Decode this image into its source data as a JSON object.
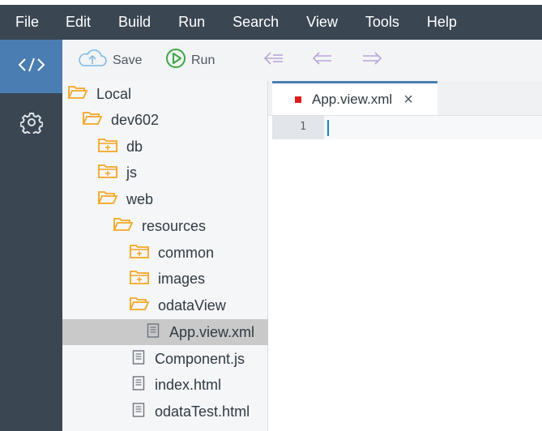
{
  "menubar": {
    "items": [
      "File",
      "Edit",
      "Build",
      "Run",
      "Search",
      "View",
      "Tools",
      "Help"
    ]
  },
  "leftbar": {
    "items": [
      {
        "icon": "code-brackets-icon",
        "active": true
      },
      {
        "icon": "gear-icon",
        "active": false
      }
    ]
  },
  "toolbar": {
    "save_label": "Save",
    "run_label": "Run",
    "icons": [
      "cloud-upload-icon",
      "play-circle-icon",
      "double-arrow-left-icon",
      "arrow-left-icon",
      "arrow-right-icon"
    ]
  },
  "tree": {
    "items": [
      {
        "label": "Local",
        "type": "folder-open"
      },
      {
        "label": "dev602",
        "type": "folder-open"
      },
      {
        "label": "db",
        "type": "folder-closed"
      },
      {
        "label": "js",
        "type": "folder-closed"
      },
      {
        "label": "web",
        "type": "folder-open"
      },
      {
        "label": "resources",
        "type": "folder-open"
      },
      {
        "label": "common",
        "type": "folder-closed"
      },
      {
        "label": "images",
        "type": "folder-closed"
      },
      {
        "label": "odataView",
        "type": "folder-open"
      },
      {
        "label": "App.view.xml",
        "type": "file",
        "selected": true
      },
      {
        "label": "Component.js",
        "type": "file"
      },
      {
        "label": "index.html",
        "type": "file"
      },
      {
        "label": "odataTest.html",
        "type": "file"
      }
    ]
  },
  "editor": {
    "tab": {
      "label": "App.view.xml",
      "close": "×",
      "modified_color": "#dd1c1c"
    },
    "line_numbers": [
      "1"
    ]
  },
  "colors": {
    "menubar_bg": "#3b4653",
    "accent": "#4a7eb3",
    "folder": "#f5a623",
    "run_green": "#3aa843",
    "cloud_blue": "#7ab8e6",
    "nav_arrows": "#b9a6d8"
  }
}
